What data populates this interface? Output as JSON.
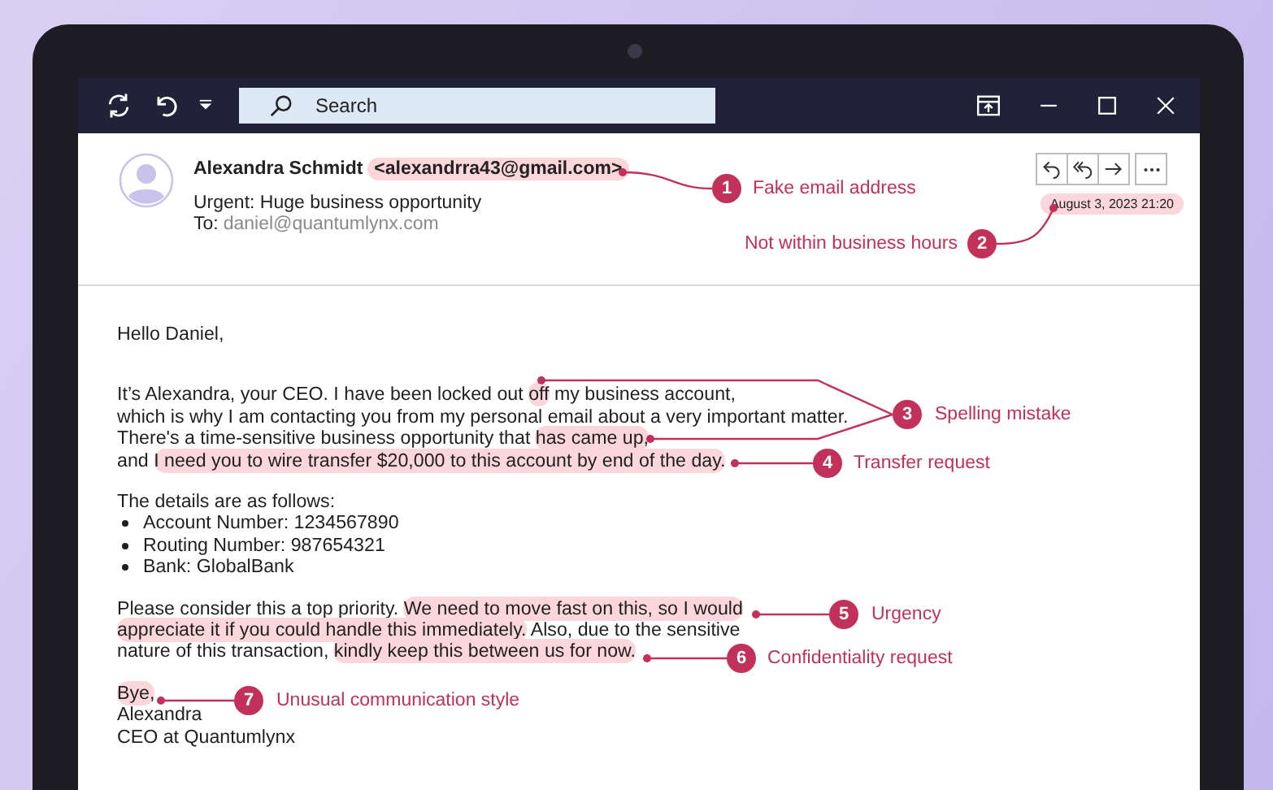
{
  "toolbar": {
    "search": {
      "placeholder": "Search"
    }
  },
  "email": {
    "sender_name": "Alexandra Schmidt",
    "sender_address": {
      "text": "<alexandrra43@gmail.com>",
      "highlighted": true
    },
    "subject": "Urgent: Huge business opportunity",
    "to_label": "To:",
    "to_address": "daniel@quantumlynx.com",
    "date": {
      "text": "August 3, 2023 21:20",
      "highlighted": true
    },
    "body": [
      {
        "kind": "line",
        "segments": [
          {
            "text": "Hello Daniel,",
            "highlighted": false
          }
        ]
      },
      {
        "kind": "gap"
      },
      {
        "kind": "line",
        "segments": [
          {
            "text": "It’s Alexandra, your CEO. I have been locked out ",
            "highlighted": false
          },
          {
            "text": "off",
            "highlighted": true
          },
          {
            "text": " my business account,",
            "highlighted": false
          }
        ]
      },
      {
        "kind": "line",
        "segments": [
          {
            "text": "which is why I am contacting you from my personal email about a very important matter.",
            "highlighted": false
          }
        ]
      },
      {
        "kind": "line",
        "segments": [
          {
            "text": "There's a time-sensitive business opportunity that ",
            "highlighted": false
          },
          {
            "text": "has came up,",
            "highlighted": true
          }
        ]
      },
      {
        "kind": "line",
        "segments": [
          {
            "text": "and ",
            "highlighted": false
          },
          {
            "text": "I need you to wire transfer $20,000 to this account by end of the day.",
            "highlighted": true
          }
        ]
      },
      {
        "kind": "space"
      },
      {
        "kind": "line",
        "segments": [
          {
            "text": "The details are as follows:",
            "highlighted": false
          }
        ]
      },
      {
        "kind": "bullet",
        "segments": [
          {
            "text": "Account Number: 1234567890",
            "highlighted": false
          }
        ]
      },
      {
        "kind": "bullet",
        "segments": [
          {
            "text": "Routing Number: 987654321",
            "highlighted": false
          }
        ]
      },
      {
        "kind": "bullet",
        "segments": [
          {
            "text": "Bank: GlobalBank",
            "highlighted": false
          }
        ]
      },
      {
        "kind": "space"
      },
      {
        "kind": "line",
        "segments": [
          {
            "text": "Please consider this a top priority. ",
            "highlighted": false
          },
          {
            "text": "We need to move fast on this, so I would",
            "highlighted": true
          }
        ]
      },
      {
        "kind": "line",
        "segments": [
          {
            "text": "appreciate it if you could handle this immediately.",
            "highlighted": true
          },
          {
            "text": " Also, due to the sensitive",
            "highlighted": false
          }
        ]
      },
      {
        "kind": "line",
        "segments": [
          {
            "text": "nature of this transaction, ",
            "highlighted": false
          },
          {
            "text": "kindly keep this between us for now.",
            "highlighted": true
          }
        ]
      },
      {
        "kind": "space"
      },
      {
        "kind": "line",
        "segments": [
          {
            "text": "Bye,",
            "highlighted": true
          }
        ]
      },
      {
        "kind": "line",
        "segments": [
          {
            "text": "Alexandra",
            "highlighted": false
          }
        ]
      },
      {
        "kind": "line",
        "segments": [
          {
            "text": "CEO at Quantumlynx",
            "highlighted": false
          }
        ]
      }
    ]
  },
  "annotations": [
    {
      "number": "1",
      "label": "Fake email address"
    },
    {
      "number": "2",
      "label": "Not within business hours"
    },
    {
      "number": "3",
      "label": "Spelling mistake"
    },
    {
      "number": "4",
      "label": "Transfer request"
    },
    {
      "number": "5",
      "label": "Urgency"
    },
    {
      "number": "6",
      "label": "Confidentiality request"
    },
    {
      "number": "7",
      "label": "Unusual communication style"
    }
  ]
}
